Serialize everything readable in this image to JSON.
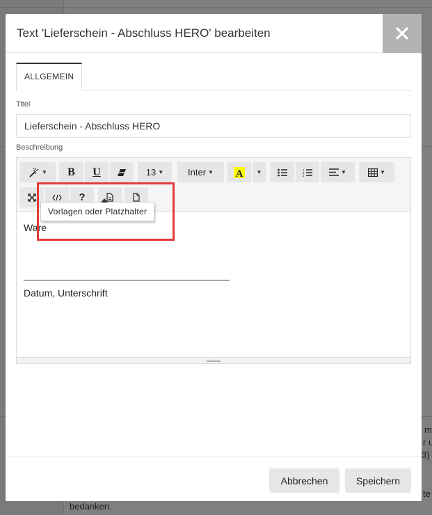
{
  "background": {
    "text_right": [
      "m",
      "r u",
      "3} S",
      "te"
    ],
    "text_bottom": "bedanken."
  },
  "modal": {
    "title": "Text 'Lieferschein - Abschluss HERO' bearbeiten",
    "close_icon": "close-icon"
  },
  "tabs": [
    {
      "label": "ALLGEMEIN",
      "active": true
    }
  ],
  "form": {
    "title_label": "Titel",
    "title_value": "Lieferschein - Abschluss HERO",
    "description_label": "Beschreibung"
  },
  "toolbar": {
    "font_size": "13",
    "font_family": "Inter",
    "highlight_color": "#ffff00",
    "icons": [
      "magic-wand-icon",
      "bold-icon",
      "underline-icon",
      "eraser-icon",
      "highlight-color-icon",
      "bullet-list-icon",
      "numbered-list-icon",
      "align-icon",
      "table-icon",
      "fullscreen-icon",
      "code-view-icon",
      "help-icon",
      "template-icon",
      "placeholder-icon"
    ]
  },
  "editor": {
    "line1": "Ware",
    "line2": "______________________________________",
    "line3": "Datum, Unterschrift"
  },
  "tooltip": {
    "text": "Vorlagen oder Platzhalter"
  },
  "footer": {
    "cancel_label": "Abbrechen",
    "save_label": "Speichern"
  },
  "colors": {
    "overlay": "#7f7f7f",
    "close_bg": "#b3b3b3",
    "highlight_box": "#e53b3b",
    "button_bg": "#e6e6e6"
  }
}
